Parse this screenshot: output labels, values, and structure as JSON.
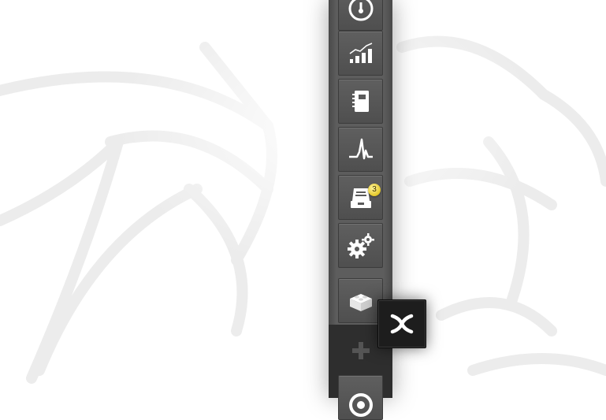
{
  "background": {
    "pattern": "spider-web",
    "base_color": "#ffffff",
    "pattern_color": "#e9e9e9"
  },
  "dock": {
    "color": "#5d5d5d",
    "items": [
      {
        "name": "dashboard",
        "icon": "speedometer-icon"
      },
      {
        "name": "statistics",
        "icon": "bar-chart-icon"
      },
      {
        "name": "notebook",
        "icon": "notebook-icon"
      },
      {
        "name": "activity",
        "icon": "pulse-icon"
      },
      {
        "name": "inbox",
        "icon": "inbox-tray-icon",
        "badge": "3"
      },
      {
        "name": "settings",
        "icon": "gears-icon"
      },
      {
        "name": "extensions",
        "icon": "lego-brick-icon"
      }
    ],
    "add_icon": "plus-icon",
    "partial_bottom_icon": "circular-icon"
  },
  "popover": {
    "icon": "close-x-icon",
    "background": "#1d1d1d"
  },
  "colors": {
    "badge": "#e3c82a",
    "icon": "#ffffff"
  }
}
